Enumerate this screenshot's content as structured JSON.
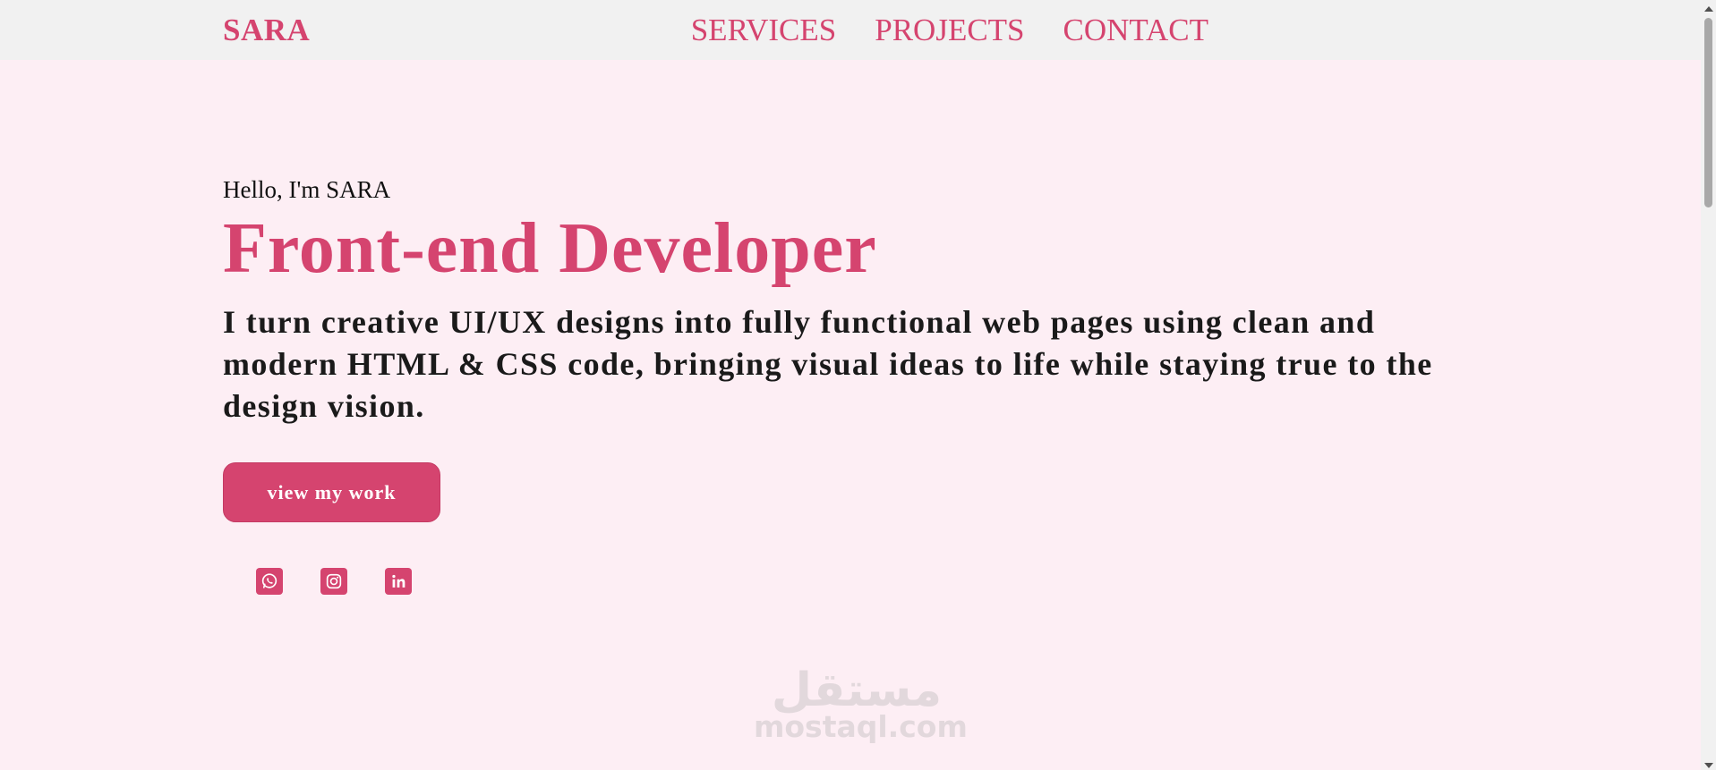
{
  "nav": {
    "brand": "SARA",
    "links": [
      "SERVICES",
      "PROJECTS",
      "CONTACT"
    ]
  },
  "hero": {
    "greeting": "Hello, I'm SARA",
    "headline": "Front-end Developer",
    "tagline": "I turn creative UI/UX designs into fully functional web pages using clean and modern HTML & CSS code, bringing visual ideas to life while staying true to the design vision.",
    "cta_label": "view my work"
  },
  "socials": [
    {
      "icon": "whatsapp-icon"
    },
    {
      "icon": "instagram-icon"
    },
    {
      "icon": "linkedin-icon"
    }
  ],
  "watermark": {
    "arabic": "مستقل",
    "latin": "mostaql.com"
  },
  "colors": {
    "accent": "#d5446f",
    "background": "#fdeef4",
    "navbar": "#f1f1f1",
    "text": "#1a1a1a"
  }
}
